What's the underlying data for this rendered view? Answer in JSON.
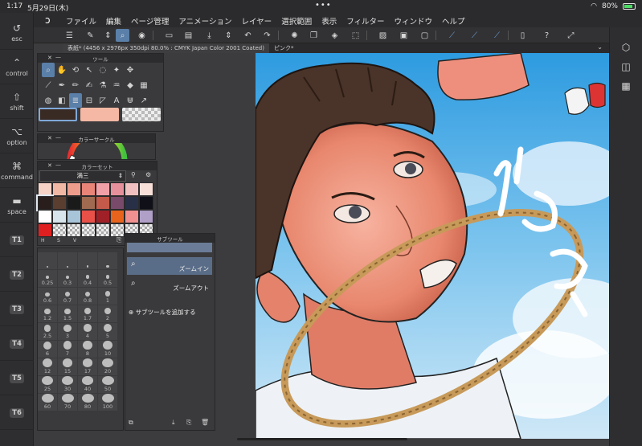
{
  "status": {
    "time": "1:17",
    "date": "5月29日(木)",
    "dots": "•••",
    "battery": "80%"
  },
  "menu": {
    "items": [
      "ファイル",
      "編集",
      "ページ管理",
      "アニメーション",
      "レイヤー",
      "選択範囲",
      "表示",
      "フィルター",
      "ウィンドウ",
      "ヘルプ"
    ]
  },
  "shortcuts": [
    {
      "icon": "undo-icon",
      "label": "esc"
    },
    {
      "icon": "caret-up-icon",
      "label": "control"
    },
    {
      "icon": "shift-arrow-icon",
      "label": "shift"
    },
    {
      "icon": "option-key-icon",
      "label": "option"
    },
    {
      "icon": "command-key-icon",
      "label": "command"
    },
    {
      "icon": "space-bar-icon",
      "label": "space"
    },
    {
      "icon": "",
      "label": "T1"
    },
    {
      "icon": "",
      "label": "T2"
    },
    {
      "icon": "",
      "label": "T3"
    },
    {
      "icon": "",
      "label": "T4"
    },
    {
      "icon": "",
      "label": "T5"
    },
    {
      "icon": "",
      "label": "T6"
    }
  ],
  "document": {
    "tab_label": "表紙* (4456 x 2976px 350dpi 80.0% : CMYK Japan Color 2001 Coated)",
    "tab2_label": "ピンク*"
  },
  "tool_panel": {
    "title": "ツール"
  },
  "color_wheel_panel": {
    "title": "カラーサークル"
  },
  "colorset_panel": {
    "title": "カラーセット",
    "set_name": "満三",
    "footer": [
      "H",
      "S",
      "V"
    ]
  },
  "subtool_panel": {
    "title": "サブツール",
    "items": [
      "ズームイン",
      "ズームアウト"
    ],
    "add_label": "サブツールを追加する"
  },
  "brush_sizes": [
    "",
    "",
    "",
    "",
    "0.25",
    "0.3",
    "0.4",
    "0.5",
    "0.6",
    "0.7",
    "0.8",
    "1",
    "1.2",
    "1.5",
    "1.7",
    "2",
    "2.5",
    "3",
    "4",
    "5",
    "6",
    "7",
    "8",
    "10",
    "12",
    "15",
    "17",
    "20",
    "25",
    "30",
    "40",
    "50",
    "60",
    "70",
    "80",
    "100"
  ],
  "colors": {
    "accent": "#5a7fa8",
    "main_color": "#3a2a24",
    "sub_color": "#f4b8a4",
    "colorset": [
      "#f6d2c6",
      "#f2b8a6",
      "#ee9c8c",
      "#e88478",
      "#f2a0a8",
      "#e6909c",
      "#f0c0c0",
      "#f8e0d8",
      "#2a1e1c",
      "#5a3e30",
      "#1a1a1a",
      "#a06a50",
      "#c45a4a",
      "#7a4a6a",
      "#283048",
      "#101018",
      "#ffffff",
      "#d8e4ec",
      "#a8c4d8",
      "#e85048",
      "#a02028",
      "#e8641c",
      "#f09090",
      "#b0a0c8",
      "#e02020",
      "",
      "",
      "",
      "",
      "",
      "",
      ""
    ]
  }
}
